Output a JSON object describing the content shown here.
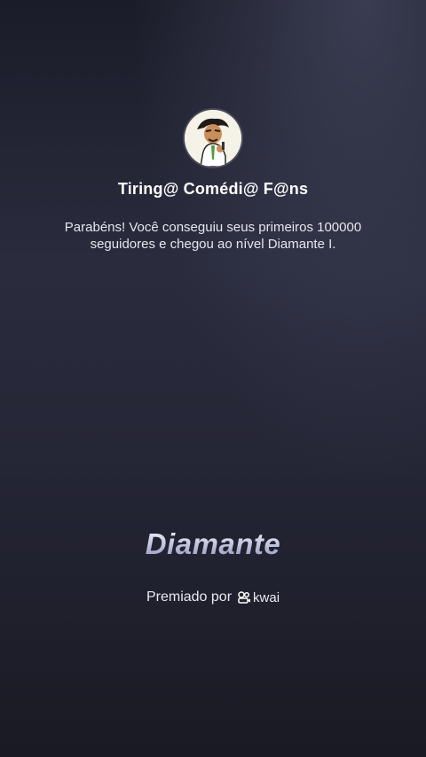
{
  "profile": {
    "username": "Tiring@ Comédi@ F@ns",
    "message": "Parabéns! Você conseguiu seus primeiros 100000 seguidores e chegou ao nível Diamante I."
  },
  "level": {
    "title": "Diamante"
  },
  "award": {
    "label": "Premiado por",
    "brand": "kwai"
  },
  "icons": {
    "avatar": "cartoon-avatar",
    "brand_logo": "kwai-logo-icon"
  },
  "colors": {
    "background": "#22232f",
    "text": "#ffffff",
    "level_gradient_top": "#f4f5ff",
    "level_gradient_bottom": "#8d90b8"
  }
}
